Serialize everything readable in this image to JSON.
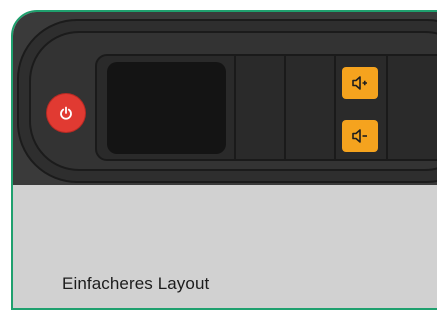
{
  "device": {
    "power_icon": "power-icon",
    "volume_up_icon": "volume-up-icon",
    "volume_down_icon": "volume-down-icon",
    "colors": {
      "card_border": "#1fa06e",
      "power": "#e13a32",
      "volume": "#f5a31e",
      "body": "#3a3a3a",
      "screen": "#141414",
      "background": "#d1d1d1"
    }
  },
  "caption": {
    "text": "Einfacheres Layout"
  }
}
